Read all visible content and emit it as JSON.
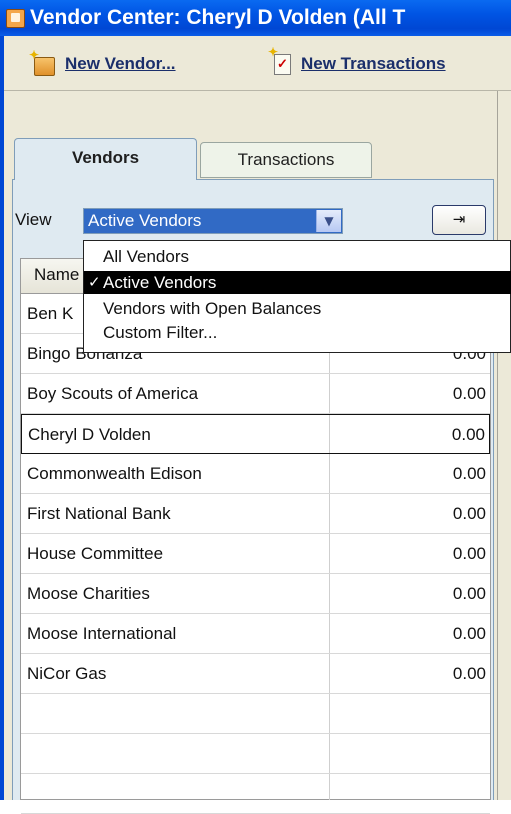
{
  "window": {
    "title": "Vendor Center: Cheryl D Volden (All T"
  },
  "toolbar": {
    "new_vendor": "New Vendor...",
    "new_transactions": "New Transactions"
  },
  "tabs": [
    {
      "label": "Vendors",
      "active": true
    },
    {
      "label": "Transactions",
      "active": false
    }
  ],
  "view": {
    "label": "View",
    "selected": "Active Vendors"
  },
  "dropdown": {
    "options": [
      {
        "label": "All Vendors",
        "checked": false
      },
      {
        "label": "Active Vendors",
        "checked": true
      },
      {
        "label": "Vendors with Open Balances",
        "checked": false
      },
      {
        "label": "Custom Filter...",
        "checked": false
      }
    ],
    "check_glyph": "✓"
  },
  "table": {
    "columns": [
      "Name"
    ],
    "rows": [
      {
        "name": "Ben K",
        "balance": ""
      },
      {
        "name": "Bingo Bonanza",
        "balance": "0.00"
      },
      {
        "name": "Boy Scouts of America",
        "balance": "0.00"
      },
      {
        "name": "Cheryl D Volden",
        "balance": "0.00"
      },
      {
        "name": "Commonwealth Edison",
        "balance": "0.00"
      },
      {
        "name": "First National Bank",
        "balance": "0.00"
      },
      {
        "name": "House Committee",
        "balance": "0.00"
      },
      {
        "name": "Moose Charities",
        "balance": "0.00"
      },
      {
        "name": "Moose International",
        "balance": "0.00"
      },
      {
        "name": "NiCor Gas",
        "balance": "0.00"
      }
    ]
  },
  "icons": {
    "app": "vendor-center-icon",
    "new_vendor": "new-vendor-icon",
    "new_transactions": "new-transactions-icon",
    "expand": "expand-arrow-icon",
    "dropdown_arrow": "chevron-down-icon"
  }
}
